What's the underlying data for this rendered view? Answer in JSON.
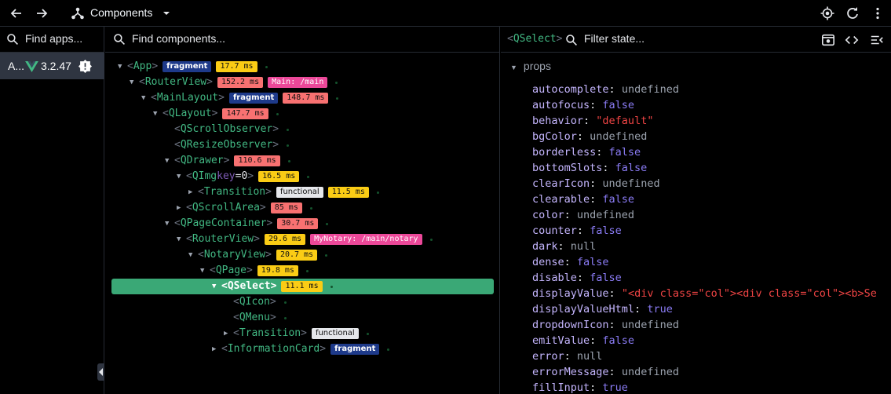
{
  "topbar": {
    "title": "Components"
  },
  "apps": {
    "search_placeholder": "Find apps...",
    "app_name": "A...",
    "app_version": "3.2.47"
  },
  "tree": {
    "search_placeholder": "Find components...",
    "nodes": [
      {
        "name": "App",
        "badges": [
          {
            "text": "fragment",
            "kind": "frag"
          },
          {
            "text": "17.7 ms",
            "kind": "yellow"
          }
        ]
      },
      {
        "name": "RouterView",
        "badges": [
          {
            "text": "152.2 ms",
            "kind": "red"
          },
          {
            "text": "Main: /main",
            "kind": "pink"
          }
        ]
      },
      {
        "name": "MainLayout",
        "badges": [
          {
            "text": "fragment",
            "kind": "frag"
          },
          {
            "text": "148.7 ms",
            "kind": "red"
          }
        ]
      },
      {
        "name": "QLayout",
        "badges": [
          {
            "text": "147.7 ms",
            "kind": "red"
          }
        ]
      },
      {
        "name": "QScrollObserver",
        "badges": []
      },
      {
        "name": "QResizeObserver",
        "badges": []
      },
      {
        "name": "QDrawer",
        "badges": [
          {
            "text": "110.6 ms",
            "kind": "red"
          }
        ]
      },
      {
        "name": "QImg",
        "attr_key": "key",
        "attr_val": "=0",
        "badges": [
          {
            "text": "16.5 ms",
            "kind": "yellow"
          }
        ]
      },
      {
        "name": "Transition",
        "badges": [
          {
            "text": "functional",
            "kind": "func"
          },
          {
            "text": "11.5 ms",
            "kind": "yellow"
          }
        ]
      },
      {
        "name": "QScrollArea",
        "badges": [
          {
            "text": "85 ms",
            "kind": "red"
          }
        ]
      },
      {
        "name": "QPageContainer",
        "badges": [
          {
            "text": "30.7 ms",
            "kind": "red"
          }
        ]
      },
      {
        "name": "RouterView",
        "badges": [
          {
            "text": "29.6 ms",
            "kind": "yellow"
          },
          {
            "text": "MyNotary: /main/notary",
            "kind": "pink"
          }
        ]
      },
      {
        "name": "NotaryView",
        "badges": [
          {
            "text": "20.7 ms",
            "kind": "yellow"
          }
        ]
      },
      {
        "name": "QPage",
        "badges": [
          {
            "text": "19.8 ms",
            "kind": "yellow"
          }
        ]
      },
      {
        "name": "QSelect",
        "badges": [
          {
            "text": "11.1 ms",
            "kind": "yellow"
          }
        ]
      },
      {
        "name": "QIcon",
        "badges": []
      },
      {
        "name": "QMenu",
        "badges": []
      },
      {
        "name": "Transition",
        "badges": [
          {
            "text": "functional",
            "kind": "func"
          }
        ]
      },
      {
        "name": "InformationCard",
        "badges": [
          {
            "text": "fragment",
            "kind": "frag"
          }
        ]
      }
    ]
  },
  "state": {
    "component": "QSelect",
    "filter_placeholder": "Filter state...",
    "section": "props",
    "props": [
      {
        "key": "autocomplete",
        "value": "undefined",
        "type": "und"
      },
      {
        "key": "autofocus",
        "value": "false",
        "type": "bool"
      },
      {
        "key": "behavior",
        "value": "\"default\"",
        "type": "str"
      },
      {
        "key": "bgColor",
        "value": "undefined",
        "type": "und"
      },
      {
        "key": "borderless",
        "value": "false",
        "type": "bool"
      },
      {
        "key": "bottomSlots",
        "value": "false",
        "type": "bool"
      },
      {
        "key": "clearIcon",
        "value": "undefined",
        "type": "und"
      },
      {
        "key": "clearable",
        "value": "false",
        "type": "bool"
      },
      {
        "key": "color",
        "value": "undefined",
        "type": "und"
      },
      {
        "key": "counter",
        "value": "false",
        "type": "bool"
      },
      {
        "key": "dark",
        "value": "null",
        "type": "null"
      },
      {
        "key": "dense",
        "value": "false",
        "type": "bool"
      },
      {
        "key": "disable",
        "value": "false",
        "type": "bool"
      },
      {
        "key": "displayValue",
        "value": "\"<div class=\"col\"><div class=\"col\"><b>Se",
        "type": "str"
      },
      {
        "key": "displayValueHtml",
        "value": "true",
        "type": "bool"
      },
      {
        "key": "dropdownIcon",
        "value": "undefined",
        "type": "und"
      },
      {
        "key": "emitValue",
        "value": "false",
        "type": "bool"
      },
      {
        "key": "error",
        "value": "null",
        "type": "null"
      },
      {
        "key": "errorMessage",
        "value": "undefined",
        "type": "und"
      },
      {
        "key": "fillInput",
        "value": "true",
        "type": "bool"
      }
    ]
  }
}
